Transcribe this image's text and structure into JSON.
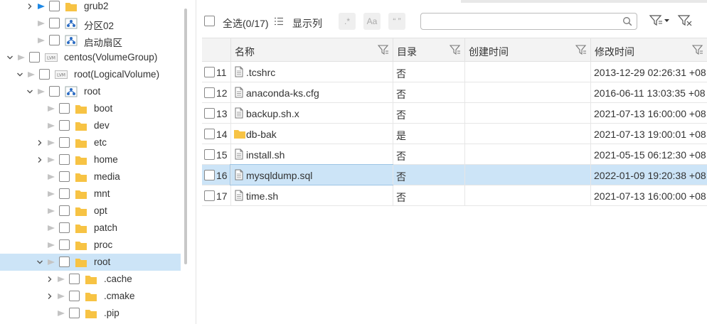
{
  "tree": {
    "items": [
      {
        "label": "grub2",
        "type": "folder",
        "arrow": "right",
        "tri": "blue"
      },
      {
        "label": "分区02",
        "type": "partition",
        "arrow": "",
        "tri": "gray"
      },
      {
        "label": "启动扇区",
        "type": "partition",
        "arrow": "",
        "tri": "gray"
      },
      {
        "label": "centos(VolumeGroup)",
        "type": "lvm",
        "arrow": "down",
        "tri": "gray"
      },
      {
        "label": "root(LogicalVolume)",
        "type": "lvm",
        "arrow": "down",
        "tri": "gray"
      },
      {
        "label": "root",
        "type": "partition",
        "arrow": "down",
        "tri": "gray"
      },
      {
        "label": "boot",
        "type": "folder",
        "arrow": "",
        "tri": "gray"
      },
      {
        "label": "dev",
        "type": "folder",
        "arrow": "",
        "tri": "gray"
      },
      {
        "label": "etc",
        "type": "folder",
        "arrow": "right",
        "tri": "gray"
      },
      {
        "label": "home",
        "type": "folder",
        "arrow": "right",
        "tri": "gray"
      },
      {
        "label": "media",
        "type": "folder",
        "arrow": "",
        "tri": "gray"
      },
      {
        "label": "mnt",
        "type": "folder",
        "arrow": "",
        "tri": "gray"
      },
      {
        "label": "opt",
        "type": "folder",
        "arrow": "",
        "tri": "gray"
      },
      {
        "label": "patch",
        "type": "folder",
        "arrow": "",
        "tri": "gray"
      },
      {
        "label": "proc",
        "type": "folder",
        "arrow": "",
        "tri": "gray"
      },
      {
        "label": "root",
        "type": "folder",
        "arrow": "down",
        "tri": "gray",
        "selected": true
      },
      {
        "label": ".cache",
        "type": "folder",
        "arrow": "right",
        "tri": "gray"
      },
      {
        "label": ".cmake",
        "type": "folder",
        "arrow": "right",
        "tri": "gray"
      },
      {
        "label": ".pip",
        "type": "folder",
        "arrow": "",
        "tri": "gray"
      }
    ]
  },
  "toolbar": {
    "select_all": "全选(0/17)",
    "show_columns": "显示列",
    "regex_icon": ".*",
    "case_icon": "Aa",
    "quote_icon": "“ ”",
    "search_placeholder": ""
  },
  "table": {
    "headers": [
      "名称",
      "目录",
      "创建时间",
      "修改时间"
    ],
    "rows": [
      {
        "num": "11",
        "name": ".tcshrc",
        "dir": "否",
        "created": "",
        "modified": "2013-12-29 02:26:31 +08",
        "type": "file"
      },
      {
        "num": "12",
        "name": "anaconda-ks.cfg",
        "dir": "否",
        "created": "",
        "modified": "2016-06-11 13:03:35 +08",
        "type": "file"
      },
      {
        "num": "13",
        "name": "backup.sh.x",
        "dir": "否",
        "created": "",
        "modified": "2021-07-13 16:00:00 +08",
        "type": "file"
      },
      {
        "num": "14",
        "name": "db-bak",
        "dir": "是",
        "created": "",
        "modified": "2021-07-13 19:00:01 +08",
        "type": "folder"
      },
      {
        "num": "15",
        "name": "install.sh",
        "dir": "否",
        "created": "",
        "modified": "2021-05-15 06:12:30 +08",
        "type": "file"
      },
      {
        "num": "16",
        "name": "mysqldump.sql",
        "dir": "否",
        "created": "",
        "modified": "2022-01-09 19:20:38 +08",
        "type": "file",
        "selected": true
      },
      {
        "num": "17",
        "name": "time.sh",
        "dir": "否",
        "created": "",
        "modified": "2021-07-13 16:00:00 +08",
        "type": "file"
      }
    ]
  },
  "colors": {
    "selection": "#cce4f7",
    "folder": "#f7c344",
    "accent": "#1e88e5"
  }
}
